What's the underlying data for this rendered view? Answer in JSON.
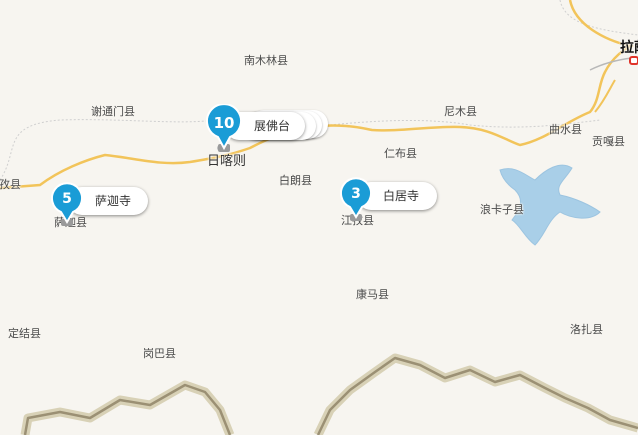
{
  "labels": {
    "lasa": "拉萨",
    "nanmulin": "南木林县",
    "xietongmen": "谢通门县",
    "nimu": "尼木县",
    "qushui": "曲水县",
    "gongga": "贡嘎县",
    "rikaze": "日喀则",
    "renbu": "仁布县",
    "bailang": "白朗县",
    "lazi": "孜县",
    "sajia": "萨迦县",
    "jiangzi": "江孜县",
    "langkazi": "浪卡子县",
    "kangma": "康马县",
    "dingjie": "定结县",
    "gangba": "岗巴县",
    "luozha": "洛扎县"
  },
  "markers": [
    {
      "count": "10",
      "name": "展佛台"
    },
    {
      "count": "5",
      "name": "萨迦寺"
    },
    {
      "count": "3",
      "name": "白居寺"
    }
  ],
  "colors": {
    "background": "#f7f5f0",
    "road": "#f2c45a",
    "marker": "#1a9cd6",
    "lake": "#a9cfe8",
    "border": "#9b9074"
  }
}
